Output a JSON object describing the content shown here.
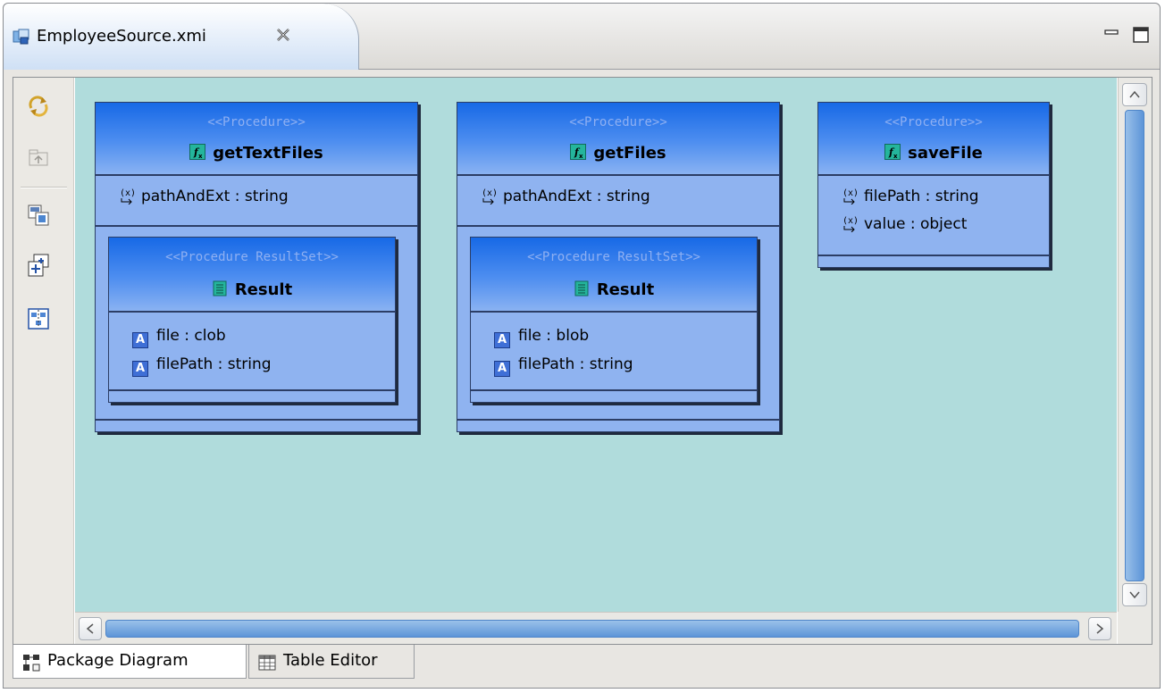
{
  "window": {
    "tab_title": "EmployeeSource.xmi",
    "tab_icon": "model-file-icon"
  },
  "palette": {
    "tools": [
      {
        "name": "refresh-icon"
      },
      {
        "name": "go-up-icon"
      },
      {
        "name": "save-diagram-icon"
      },
      {
        "name": "add-object-icon"
      },
      {
        "name": "auto-layout-icon"
      }
    ]
  },
  "diagram": {
    "procedures": [
      {
        "stereotype": "<<Procedure>>",
        "name": "getTextFiles",
        "params": [
          {
            "text": "pathAndExt : string"
          }
        ],
        "resultset": {
          "stereotype": "<<Procedure ResultSet>>",
          "name": "Result",
          "columns": [
            {
              "text": "file : clob"
            },
            {
              "text": "filePath : string"
            }
          ]
        }
      },
      {
        "stereotype": "<<Procedure>>",
        "name": "getFiles",
        "params": [
          {
            "text": "pathAndExt : string"
          }
        ],
        "resultset": {
          "stereotype": "<<Procedure ResultSet>>",
          "name": "Result",
          "columns": [
            {
              "text": "file : blob"
            },
            {
              "text": "filePath : string"
            }
          ]
        }
      },
      {
        "stereotype": "<<Procedure>>",
        "name": "saveFile",
        "params": [
          {
            "text": "filePath : string"
          },
          {
            "text": "value : object"
          }
        ]
      }
    ]
  },
  "bottom_tabs": [
    {
      "label": "Package Diagram",
      "active": true
    },
    {
      "label": "Table Editor",
      "active": false
    }
  ],
  "colors": {
    "canvas": "#b0dcdc",
    "box_fill": "#8fb3f0",
    "header_top": "#1769e6"
  }
}
